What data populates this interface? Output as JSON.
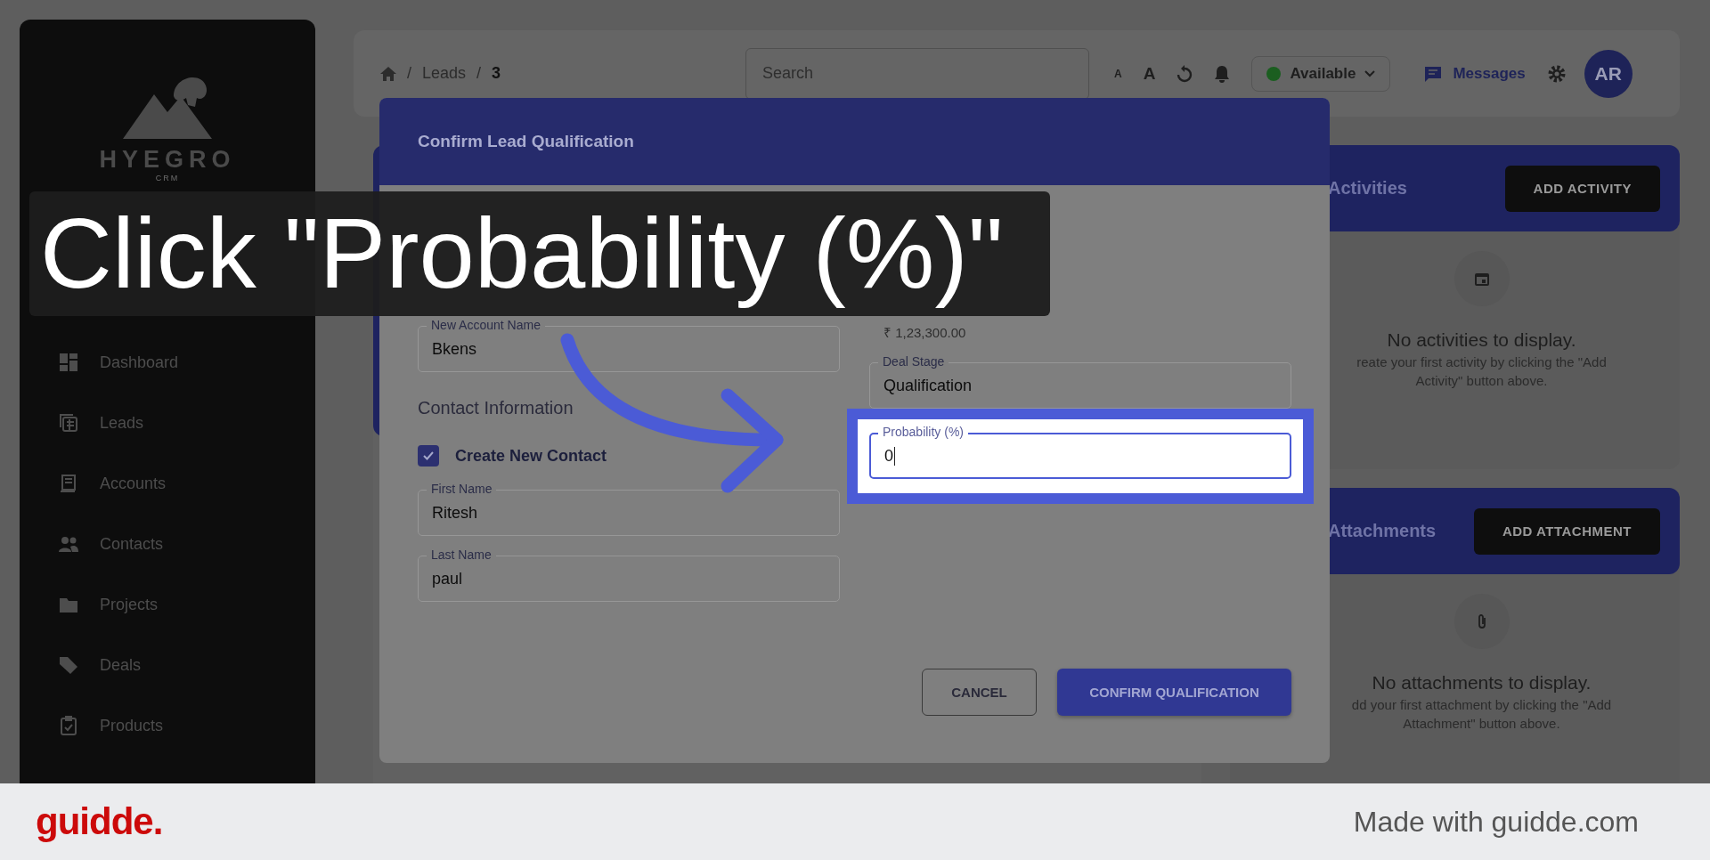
{
  "sidebar": {
    "logo_text": "HYEGRO",
    "logo_subtext": "CRM",
    "items": [
      {
        "label": "Dashboard",
        "selected": false
      },
      {
        "label": "Leads",
        "selected": false
      },
      {
        "label": "Accounts",
        "selected": false
      },
      {
        "label": "Contacts",
        "selected": false
      },
      {
        "label": "Projects",
        "selected": false
      },
      {
        "label": "Deals",
        "selected": false
      },
      {
        "label": "Products",
        "selected": false
      }
    ]
  },
  "header": {
    "breadcrumb": [
      {
        "separator": "/",
        "label": "Leads"
      },
      {
        "separator": "/",
        "label": "3"
      }
    ],
    "search": {
      "placeholder": "Search"
    },
    "font_buttons": [
      "A",
      "A"
    ],
    "status": "Available",
    "messages": "Messages",
    "avatar": "AR"
  },
  "modal": {
    "title": "Confirm Lead Qualification",
    "account_field": {
      "label": "New Account Name",
      "value": "Bkens"
    },
    "contact_section": "Contact Information",
    "create_contact": {
      "label": "Create New Contact",
      "checked": true
    },
    "contact_fields": [
      {
        "label": "First Name",
        "value": "Ritesh"
      },
      {
        "label": "Last Name",
        "value": "paul"
      }
    ],
    "deal_value_hint": "₹ 1,23,300.00",
    "deal_stage": {
      "label": "Deal Stage",
      "value": "Qualification"
    },
    "probability": {
      "label": "Probability (%)",
      "value": "0",
      "focused": true
    },
    "buttons": {
      "cancel": "CANCEL",
      "confirm": "CONFIRM QUALIFICATION"
    }
  },
  "panels": [
    {
      "title": "Activities",
      "button": "ADD ACTIVITY",
      "empty_title": "No activities to display.",
      "empty_lines": [
        "reate your first activity by clicking the \"Add",
        "Activity\" button above."
      ]
    },
    {
      "title": "Attachments",
      "button": "ADD ATTACHMENT",
      "empty_title": "No attachments to display.",
      "empty_lines": [
        "dd your first attachment by clicking the \"Add",
        "Attachment\" button above."
      ]
    }
  ],
  "caption": "Click \"Probability (%)\"",
  "footer": {
    "brand": "guidde.",
    "tagline": "Made with guidde.com"
  }
}
